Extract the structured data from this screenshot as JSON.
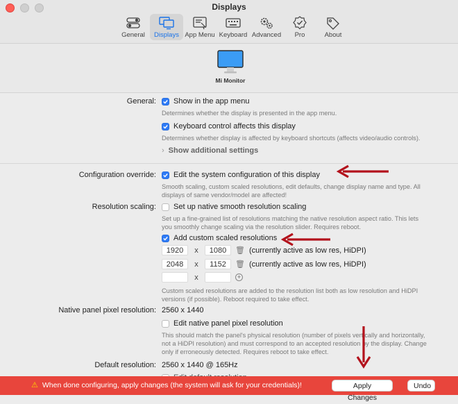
{
  "window": {
    "title": "Displays"
  },
  "toolbar": {
    "items": [
      {
        "label": "General",
        "icon": "toggles-icon"
      },
      {
        "label": "Displays",
        "icon": "displays-icon",
        "active": true
      },
      {
        "label": "App Menu",
        "icon": "app-menu-icon"
      },
      {
        "label": "Keyboard",
        "icon": "keyboard-icon"
      },
      {
        "label": "Advanced",
        "icon": "gears-icon"
      },
      {
        "label": "Pro",
        "icon": "badge-check-icon"
      },
      {
        "label": "About",
        "icon": "tag-icon"
      }
    ]
  },
  "display": {
    "name": "Mi Monitor",
    "accent": "#3b9cf5"
  },
  "general": {
    "label": "General:",
    "show_menu": {
      "label": "Show in the app menu",
      "checked": true,
      "desc": "Determines whether the display is presented in the app menu."
    },
    "keyboard": {
      "label": "Keyboard control affects this display",
      "checked": true,
      "desc": "Determines whether display is affected by keyboard shortcuts (affects video/audio controls)."
    },
    "additional": "Show additional settings"
  },
  "override": {
    "label": "Configuration override:",
    "edit": {
      "label": "Edit the system configuration of this display",
      "checked": true
    },
    "desc1": "Smooth scaling, custom scaled resolutions, edit defaults, change display name and type. All",
    "desc2": "displays of same vendor/model are affected!"
  },
  "scaling": {
    "label": "Resolution scaling:",
    "native_smooth": {
      "label": "Set up native smooth resolution scaling",
      "checked": false
    },
    "desc1": "Set up a fine-grained list of resolutions matching the native resolution aspect ratio. This lets",
    "desc2": "you smoothly change scaling via the resolution slider. Requires reboot.",
    "custom": {
      "label": "Add custom scaled resolutions",
      "checked": true
    },
    "resolutions": [
      {
        "w": "1920",
        "h": "1080",
        "note": "(currently active as low res, HiDPI)"
      },
      {
        "w": "2048",
        "h": "1152",
        "note": "(currently active as low res, HiDPI)"
      }
    ],
    "x": "x",
    "desc3": "Custom scaled resolutions are added to the resolution list both as low resolution and HiDPI",
    "desc4": "versions (if possible). Reboot required to take effect."
  },
  "native_panel": {
    "label": "Native panel pixel resolution:",
    "value": "2560 x 1440",
    "edit": {
      "label": "Edit native panel pixel resolution",
      "checked": false
    },
    "desc1": "This should match the panel's physical resolution (number of pixels vertically and horizontally,",
    "desc2": "not a HiDPI resolution) and must correspond to an accepted resolution by the display. Change",
    "desc3": "only if erroneously detected. Requires reboot to take effect."
  },
  "default_res": {
    "label": "Default resolution:",
    "value": "2560 x 1440 @ 165Hz",
    "partial": "Edit default resolution"
  },
  "bottom": {
    "warning": "When done configuring, apply changes (the system will ask for your credentials)!",
    "apply": "Apply Changes",
    "undo": "Undo",
    "bar_color": "#e8453c"
  },
  "annotation_color": "#b3121c"
}
